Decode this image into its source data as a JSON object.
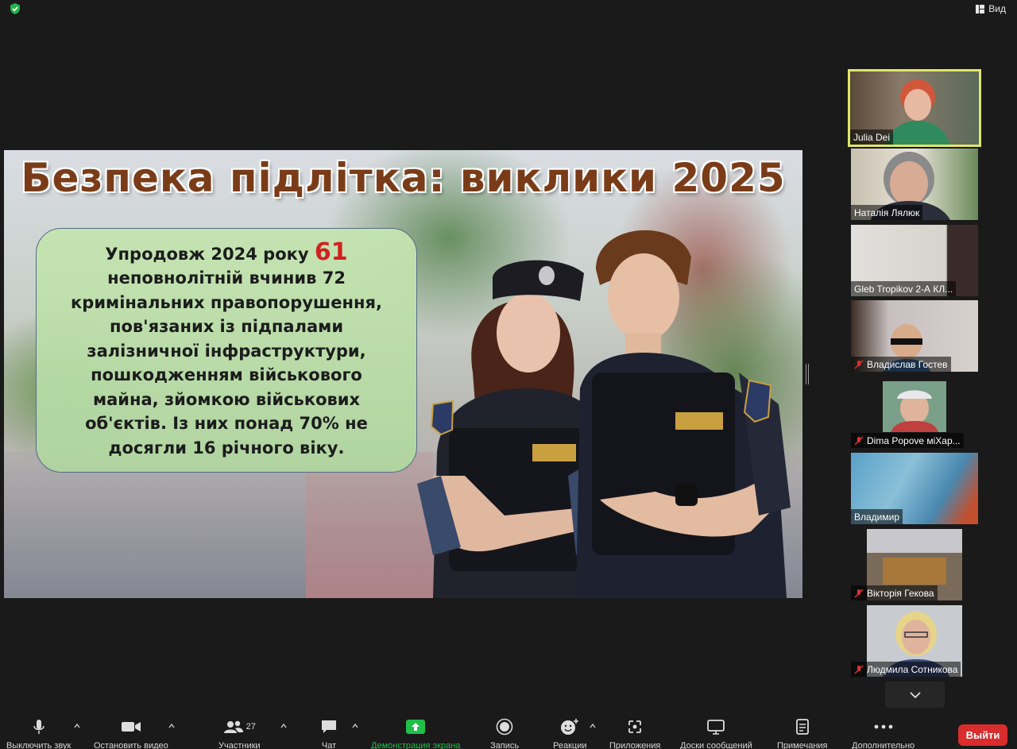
{
  "topbar": {
    "view_label": "Вид"
  },
  "slide": {
    "title": "Безпека підлітка: виклики 2025",
    "lines": [
      {
        "pre": "Упродовж 2024 року ",
        "highlight": "61"
      },
      {
        "text": "неповнолітній вчинив 72"
      },
      {
        "text": "кримінальних правопорушення,"
      },
      {
        "text": "пов'язаних із підпалами"
      },
      {
        "text": "залізничної інфраструктури,"
      },
      {
        "text": "пошкодженням військового"
      },
      {
        "text": "майна, зйомкою військових"
      },
      {
        "text": "об'єктів. Із них понад 70% не"
      },
      {
        "text": "досягли 16 річного віку."
      }
    ],
    "highlight_color": "#d22020"
  },
  "participants": [
    {
      "name": "Julia Dei",
      "muted": false,
      "active": true
    },
    {
      "name": "Наталія Лялюк",
      "muted": false,
      "active": false
    },
    {
      "name": "Gleb Tropikov  2-А    КЛ...",
      "muted": false,
      "active": false
    },
    {
      "name": "Владислав Гостев",
      "muted": true,
      "active": false
    },
    {
      "name": "Dima Popove  міХар...",
      "muted": true,
      "active": false
    },
    {
      "name": "Владимир",
      "muted": false,
      "active": false
    },
    {
      "name": "Вікторія Гекова",
      "muted": true,
      "active": false
    },
    {
      "name": "Людмила Сотникова",
      "muted": true,
      "active": false
    }
  ],
  "toolbar": {
    "mute": "Выключить звук",
    "video": "Остановить видео",
    "participants": "Участники",
    "participants_count": "27",
    "chat": "Чат",
    "share": "Демонстрация экрана",
    "record": "Запись",
    "reactions": "Реакции",
    "apps": "Приложения",
    "whiteboards": "Доски сообщений",
    "notes": "Примечания",
    "more": "Дополнительно",
    "leave": "Выйти"
  },
  "colors": {
    "share_green": "#1fbf4a",
    "leave_red": "#d92d2d",
    "active_border": "#dfe668"
  }
}
